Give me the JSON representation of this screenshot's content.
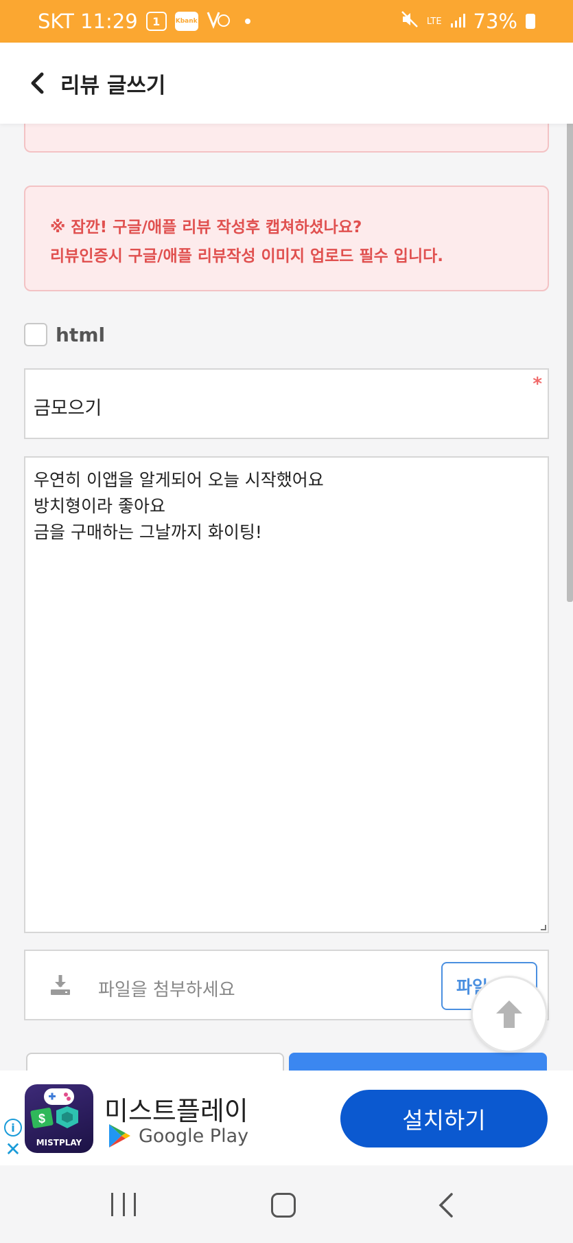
{
  "status_bar": {
    "carrier_time": "SKT 11:29",
    "badge1": "1",
    "kbank": "Kbank",
    "network": "LTE",
    "battery": "73%"
  },
  "header": {
    "title": "리뷰 글쓰기"
  },
  "notice": {
    "line1": "※ 잠깐! 구글/애플 리뷰 작성후 캡쳐하셨나요?",
    "line2": "리뷰인증시 구글/애플 리뷰작성 이미지 업로드 필수 입니다."
  },
  "html_option": {
    "label": "html",
    "checked": false
  },
  "subject": {
    "value": "금모으기",
    "required_mark": "*"
  },
  "content": {
    "lines": [
      "우연히 이앱을 알게되어 오늘 시작했어요",
      "방치형이라 좋아요",
      "금을 구매하는 그날까지 화이팅!"
    ]
  },
  "file_attach": {
    "placeholder": "파일을 첨부하세요",
    "button_label": "파일"
  },
  "ad": {
    "logo_text": "MISTPLAY",
    "title": "미스트플레이",
    "store": "Google Play",
    "install_label": "설치하기"
  },
  "colors": {
    "status_bar": "#fba731",
    "notice_bg": "#fdebec",
    "notice_text": "#e0504f",
    "accent_blue": "#3b87f0",
    "install_blue": "#0b59d0"
  }
}
